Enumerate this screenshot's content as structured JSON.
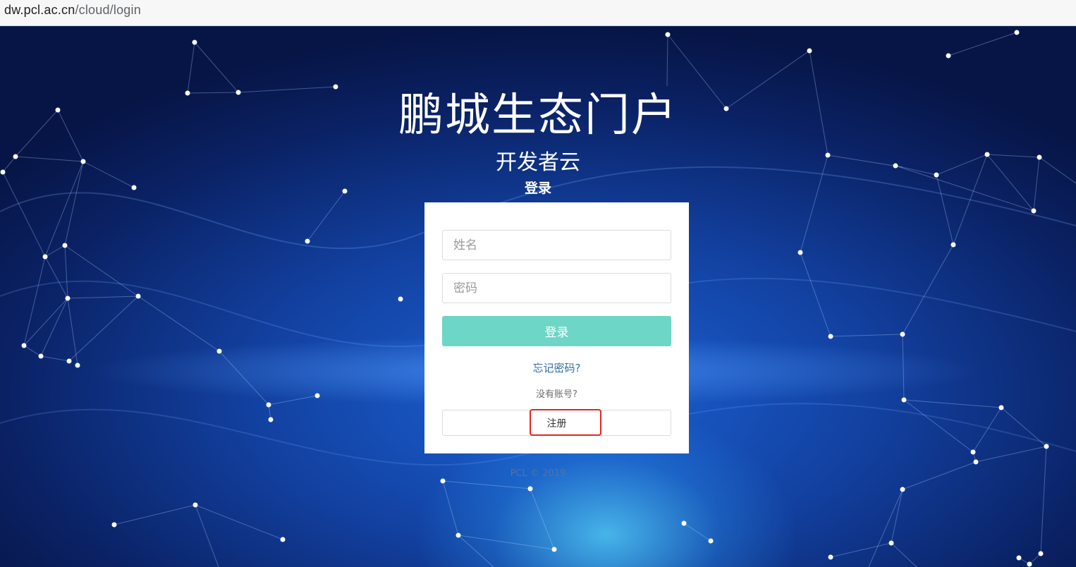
{
  "browser": {
    "url_host": "dw.pcl.ac.cn",
    "url_path": "/cloud/login"
  },
  "header": {
    "title": "鹏城生态门户",
    "subtitle": "开发者云",
    "login_heading": "登录"
  },
  "form": {
    "name_placeholder": "姓名",
    "password_placeholder": "密码",
    "login_label": "登录",
    "forgot_label": "忘记密码?",
    "no_account_label": "没有账号?",
    "register_label": "注册"
  },
  "footer": {
    "copyright": "PCL © 2019"
  },
  "colors": {
    "login_button": "#6dd6c6",
    "link": "#2e6da4",
    "highlight_box": "#e4261d",
    "background": "#12409f"
  }
}
